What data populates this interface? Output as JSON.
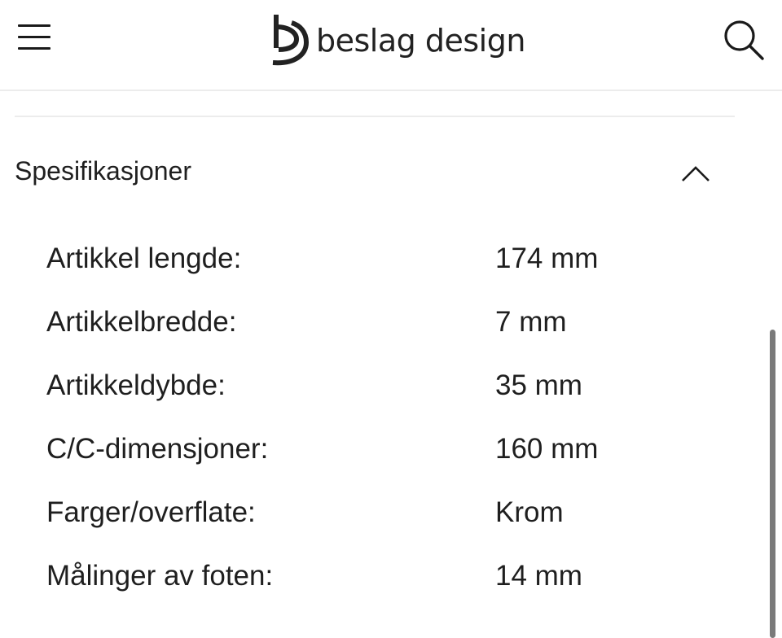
{
  "header": {
    "brand_name": "beslag design",
    "menu_icon": "hamburger-menu-icon",
    "search_icon": "search-icon"
  },
  "section": {
    "title": "Spesifikasjoner",
    "toggle_icon": "chevron-up-icon",
    "expanded": true
  },
  "specs": [
    {
      "label": "Artikkel lengde:",
      "value": "174 mm"
    },
    {
      "label": "Artikkelbredde:",
      "value": "7 mm"
    },
    {
      "label": "Artikkeldybde:",
      "value": "35 mm"
    },
    {
      "label": "C/C-dimensjoner:",
      "value": "160 mm"
    },
    {
      "label": "Farger/overflate:",
      "value": "Krom"
    },
    {
      "label": "Målinger av foten:",
      "value": "14 mm"
    }
  ],
  "colors": {
    "text": "#1f1f1f",
    "divider": "#ececec",
    "scrollbar": "#7a7a7a"
  }
}
